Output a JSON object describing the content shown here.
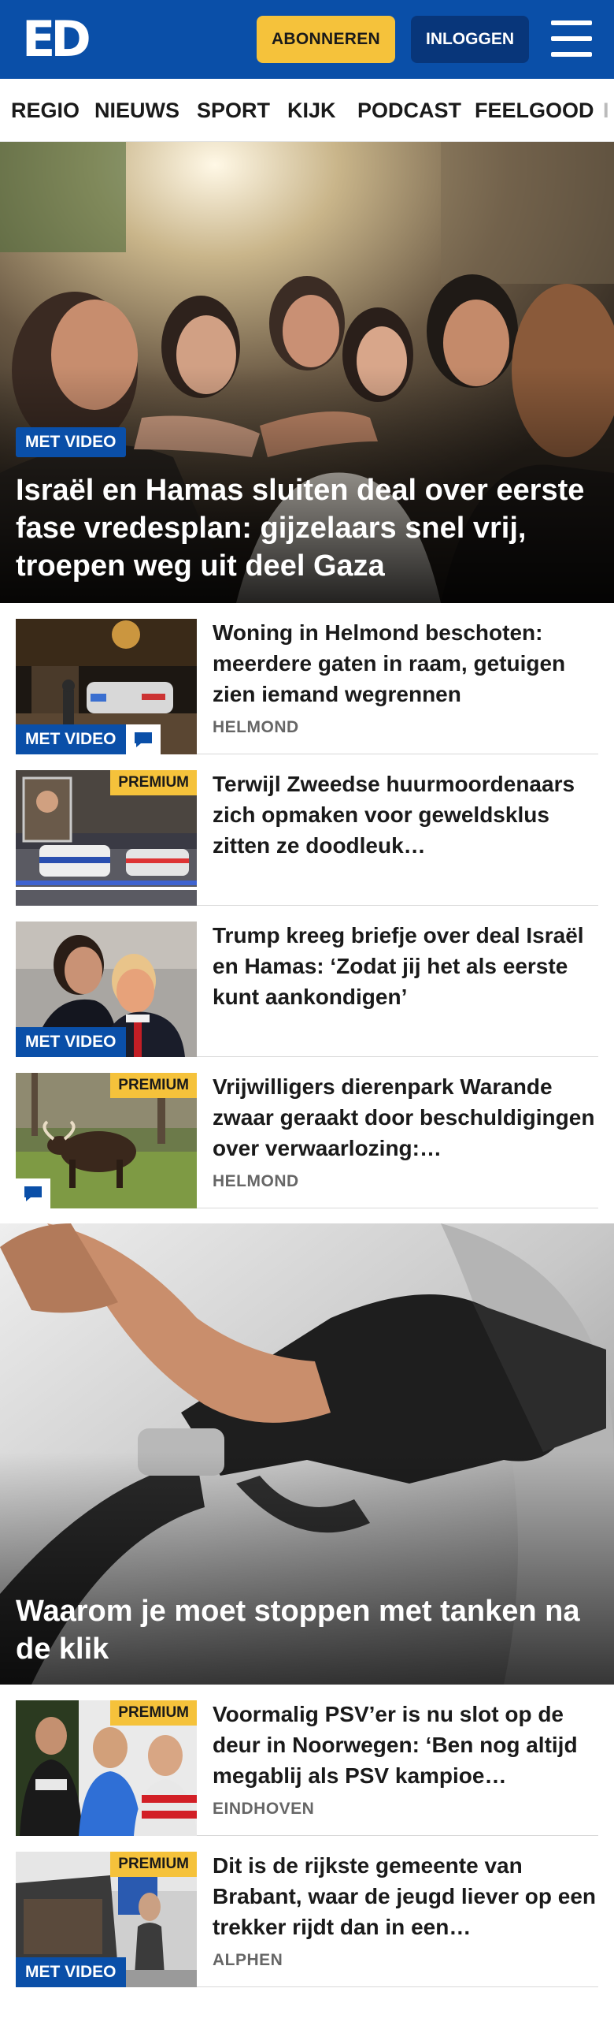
{
  "header": {
    "logo_text": "ED",
    "subscribe_label": "ABONNEREN",
    "login_label": "INLOGGEN",
    "menu_icon": "hamburger-menu-icon",
    "bg_color": "#0a4fa8",
    "accent_color": "#f5c23b"
  },
  "nav": {
    "items": [
      "REGIO",
      "NIEUWS",
      "SPORT",
      "KIJK",
      "PODCAST",
      "FEELGOOD",
      "I"
    ]
  },
  "hero": {
    "badge": "MET VIDEO",
    "title": "Israël en Hamas sluiten deal over eerste fase vredesplan: gijzelaars snel vrij, troepen weg uit deel Gaza"
  },
  "articles": [
    {
      "title": "Woning in Helmond beschoten: meerdere gaten in raam, getuigen zien iemand wegrennen",
      "tag": "HELMOND",
      "badge": "MET VIDEO",
      "comment_icon": "comment-icon"
    },
    {
      "title": "Terwijl Zweedse huurmoorde­naars zich opmaken voor geweldsklus zitten ze doodleuk…",
      "premium": "PREMIUM"
    },
    {
      "title": "Trump kreeg briefje over deal Israël en Hamas: ‘Zodat jij het als eerste kunt aankondigen’",
      "badge": "MET VIDEO"
    },
    {
      "title": "Vrijwilligers dierenpark Warande zwaar geraakt door beschuldigin­gen over verwaarlozing:…",
      "tag": "HELMOND",
      "premium": "PREMIUM",
      "comment_icon": "comment-icon"
    }
  ],
  "promo": {
    "title": "Waarom je moet stoppen met tanken na de klik"
  },
  "articles_2": [
    {
      "title": "Voormalig PSV’er is nu slot op de deur in Noorwegen: ‘Ben nog altijd megablij als PSV kampioe…",
      "tag": "EINDHOVEN",
      "premium": "PREMIUM"
    },
    {
      "title": "Dit is de rijkste gemeente van Brabant, waar de jeugd liever op een trekker rijdt dan in een…",
      "tag": "ALPHEN",
      "premium": "PREMIUM",
      "badge": "MET VIDEO"
    }
  ]
}
